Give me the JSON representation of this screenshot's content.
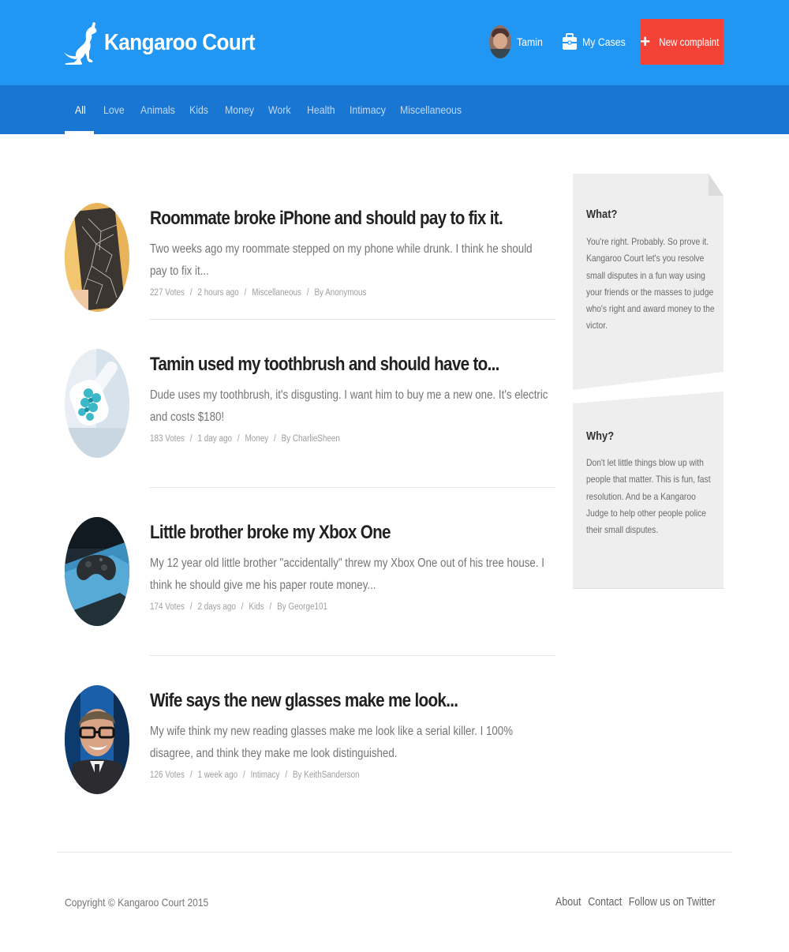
{
  "header": {
    "brand_name": "Kangaroo Court",
    "user_name": "Tamin",
    "my_cases_label": "My Cases",
    "new_complaint_label": "New complaint"
  },
  "categories": [
    "All",
    "Love",
    "Animals",
    "Kids",
    "Money",
    "Work",
    "Health",
    "Intimacy",
    "Miscellaneous"
  ],
  "active_category": "All",
  "cases": [
    {
      "title": "Roommate broke iPhone and should pay to fix it.",
      "description": "Two weeks ago my roommate stepped on my phone while drunk. I think he should pay to fix it...",
      "votes": "227 Votes",
      "time": "2 hours ago",
      "category": "Miscellaneous",
      "author": "By Anonymous"
    },
    {
      "title": "Tamin used my toothbrush and should have to...",
      "description": "Dude uses my toothbrush, it's disgusting. I want him to buy me a new one. It's electric and costs $180!",
      "votes": "183 Votes",
      "time": "1 day ago",
      "category": "Money",
      "author": "By CharlieSheen"
    },
    {
      "title": "Little brother broke my Xbox One",
      "description": "My 12 year old little brother \"accidentally\" threw my Xbox One out of his tree house. I think he should give me his paper route money...",
      "votes": "174 Votes",
      "time": "2 days ago",
      "category": "Kids",
      "author": "By George101"
    },
    {
      "title": "Wife says the new glasses make me look...",
      "description": "My wife think my new reading glasses make me look like a serial killer. I 100% disagree, and think they make me look distinguished.",
      "votes": "126 Votes",
      "time": "1 week ago",
      "category": "Intimacy",
      "author": "By KeithSanderson"
    }
  ],
  "sidebar": {
    "what_title": "What?",
    "what_text": "You're right. Probably. So prove it. Kangaroo Court let's you resolve small disputes in a fun way using your friends or the masses to judge who's right and award money to the victor.",
    "why_title": "Why?",
    "why_text": "Don't let little things blow up with people that matter. This is fun, fast resolution. And be a Kangaroo Judge to help other people police their small disputes."
  },
  "footer": {
    "copyright": "Copyright © Kangaroo Court 2015",
    "links": [
      "About",
      "Contact",
      "Follow us on Twitter"
    ]
  },
  "colors": {
    "primary": "#2196f3",
    "primary_dark": "#1976d2",
    "accent": "#f44336",
    "card_bg": "#eeeeee"
  }
}
